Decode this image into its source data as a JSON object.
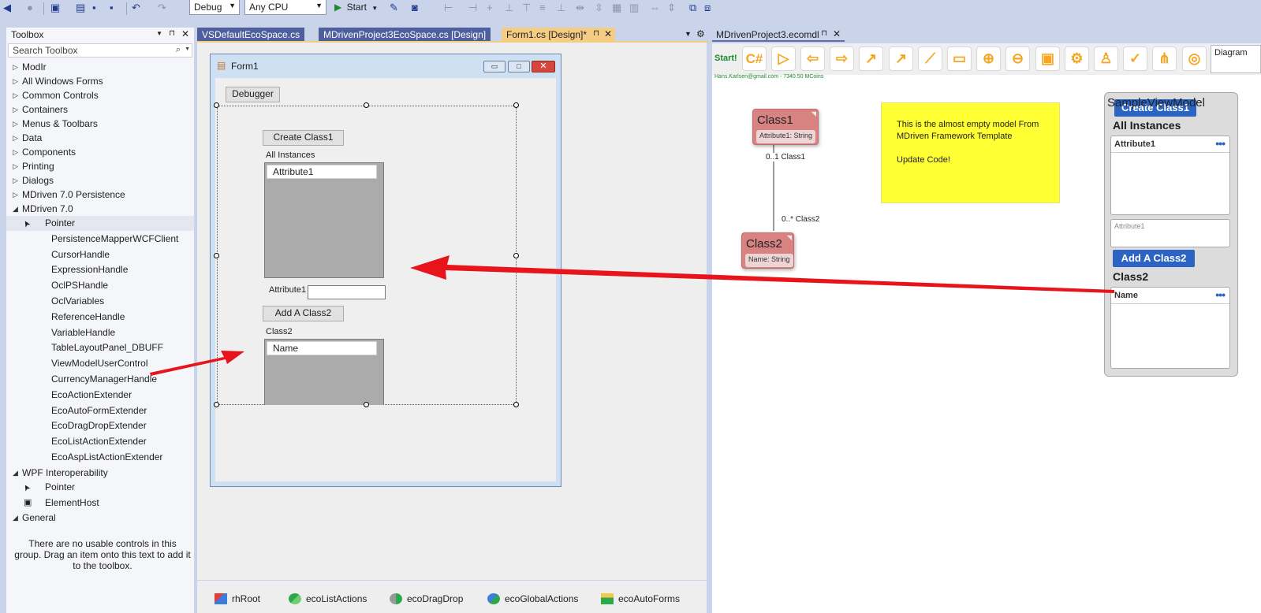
{
  "toolbar": {
    "config": "Debug",
    "platform": "Any CPU",
    "start_label": "Start"
  },
  "toolbox": {
    "title": "Toolbox",
    "search_placeholder": "Search Toolbox",
    "groups_collapsed": [
      "ModIr",
      "All Windows Forms",
      "Common Controls",
      "Containers",
      "Menus & Toolbars",
      "Data",
      "Components",
      "Printing",
      "Dialogs",
      "MDriven 7.0 Persistence"
    ],
    "mdriven_group": "MDriven 7.0",
    "mdriven_items": [
      "Pointer",
      "PersistenceMapperWCFClient",
      "CursorHandle",
      "ExpressionHandle",
      "OclPSHandle",
      "OclVariables",
      "ReferenceHandle",
      "VariableHandle",
      "TableLayoutPanel_DBUFF",
      "ViewModelUserControl",
      "CurrencyManagerHandle",
      "EcoActionExtender",
      "EcoAutoFormExtender",
      "EcoDragDropExtender",
      "EcoListActionExtender",
      "EcoAspListActionExtender"
    ],
    "wpf_group": "WPF Interoperability",
    "wpf_items": [
      "Pointer",
      "ElementHost"
    ],
    "general_group": "General",
    "general_empty_text": "There are no usable controls in this group. Drag an item onto this text to add it to the toolbox."
  },
  "doc_tabs": [
    "VSDefaultEcoSpace.cs",
    "MDrivenProject3EcoSpace.cs [Design]",
    "Form1.cs [Design]*"
  ],
  "form": {
    "title": "Form1",
    "debugger_button": "Debugger",
    "create_class1_button": "Create Class1",
    "all_instances_label": "All Instances",
    "grid1_header": "Attribute1",
    "attribute1_label": "Attribute1",
    "add_class2_button": "Add A Class2",
    "class2_label": "Class2",
    "grid2_header": "Name"
  },
  "tray": [
    "rhRoot",
    "ecoListActions",
    "ecoDragDrop",
    "ecoGlobalActions",
    "ecoAutoForms"
  ],
  "modeler": {
    "tab": "MDrivenProject3.ecomdl",
    "start_label": "Start!",
    "csharp_label": "C#",
    "diagram_label": "Diagram",
    "account": "Hans.Karlsen@gmail.com - 7340.50 MCoins",
    "class1": {
      "name": "Class1",
      "attr": "Attribute1: String"
    },
    "class2": {
      "name": "Class2",
      "attr": "Name: String"
    },
    "assoc_end1": "0..1 Class1",
    "assoc_end2": "0..* Class2",
    "note": [
      "This is the almost empty model From",
      "MDriven Framework Template",
      "",
      "Update Code!"
    ],
    "viewmodel": {
      "title": "SampleViewModel",
      "create_button": "Create Class1",
      "all_instances": "All Instances",
      "grid1_header": "Attribute1",
      "field_placeholder": "Attribute1",
      "add_button": "Add A Class2",
      "class2_label": "Class2",
      "grid2_header": "Name"
    }
  },
  "colors": {
    "accent": "#f5a623",
    "arrow": "#e8141b",
    "note": "#ffff33",
    "vm_button": "#2b64c2",
    "uml_class": "#d98282"
  }
}
